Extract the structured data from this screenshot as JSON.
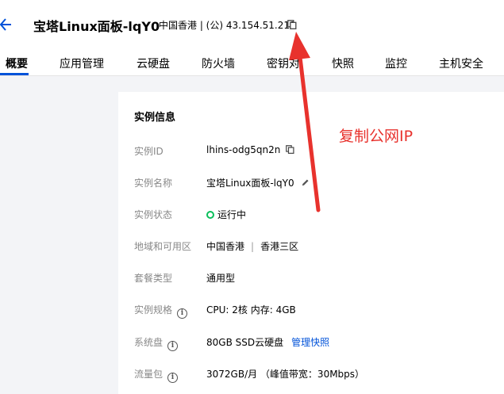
{
  "header": {
    "title": "宝塔Linux面板-lqY0",
    "ip_info": "中国香港 | (公) 43.154.51.211"
  },
  "tabs": [
    {
      "label": "概要",
      "active": true
    },
    {
      "label": "应用管理"
    },
    {
      "label": "云硬盘"
    },
    {
      "label": "防火墙"
    },
    {
      "label": "密钥对"
    },
    {
      "label": "快照"
    },
    {
      "label": "监控"
    },
    {
      "label": "主机安全"
    }
  ],
  "card": {
    "title": "实例信息",
    "rows": {
      "instance_id": {
        "label": "实例ID",
        "value": "lhins-odg5qn2n"
      },
      "instance_name": {
        "label": "实例名称",
        "value": "宝塔Linux面板-lqY0"
      },
      "instance_status": {
        "label": "实例状态",
        "value": "运行中"
      },
      "region": {
        "label": "地域和可用区",
        "region": "中国香港",
        "separator": "|",
        "zone": "香港三区"
      },
      "package_type": {
        "label": "套餐类型",
        "value": "通用型"
      },
      "instance_spec": {
        "label": "实例规格",
        "value": "CPU: 2核 内存: 4GB"
      },
      "system_disk": {
        "label": "系统盘",
        "value": "80GB SSD云硬盘",
        "link": "管理快照"
      },
      "traffic_package": {
        "label": "流量包",
        "value": "3072GB/月 （峰值带宽：30Mbps）"
      }
    }
  },
  "annotation": {
    "text": "复制公网IP",
    "color": "#e8322d"
  },
  "icons": [
    "back-arrow-icon",
    "copy-icon",
    "edit-icon",
    "info-icon",
    "status-dot-icon"
  ],
  "colors": {
    "accent": "#0052d9",
    "status_running": "#0abf5b",
    "annotation": "#e8322d"
  }
}
